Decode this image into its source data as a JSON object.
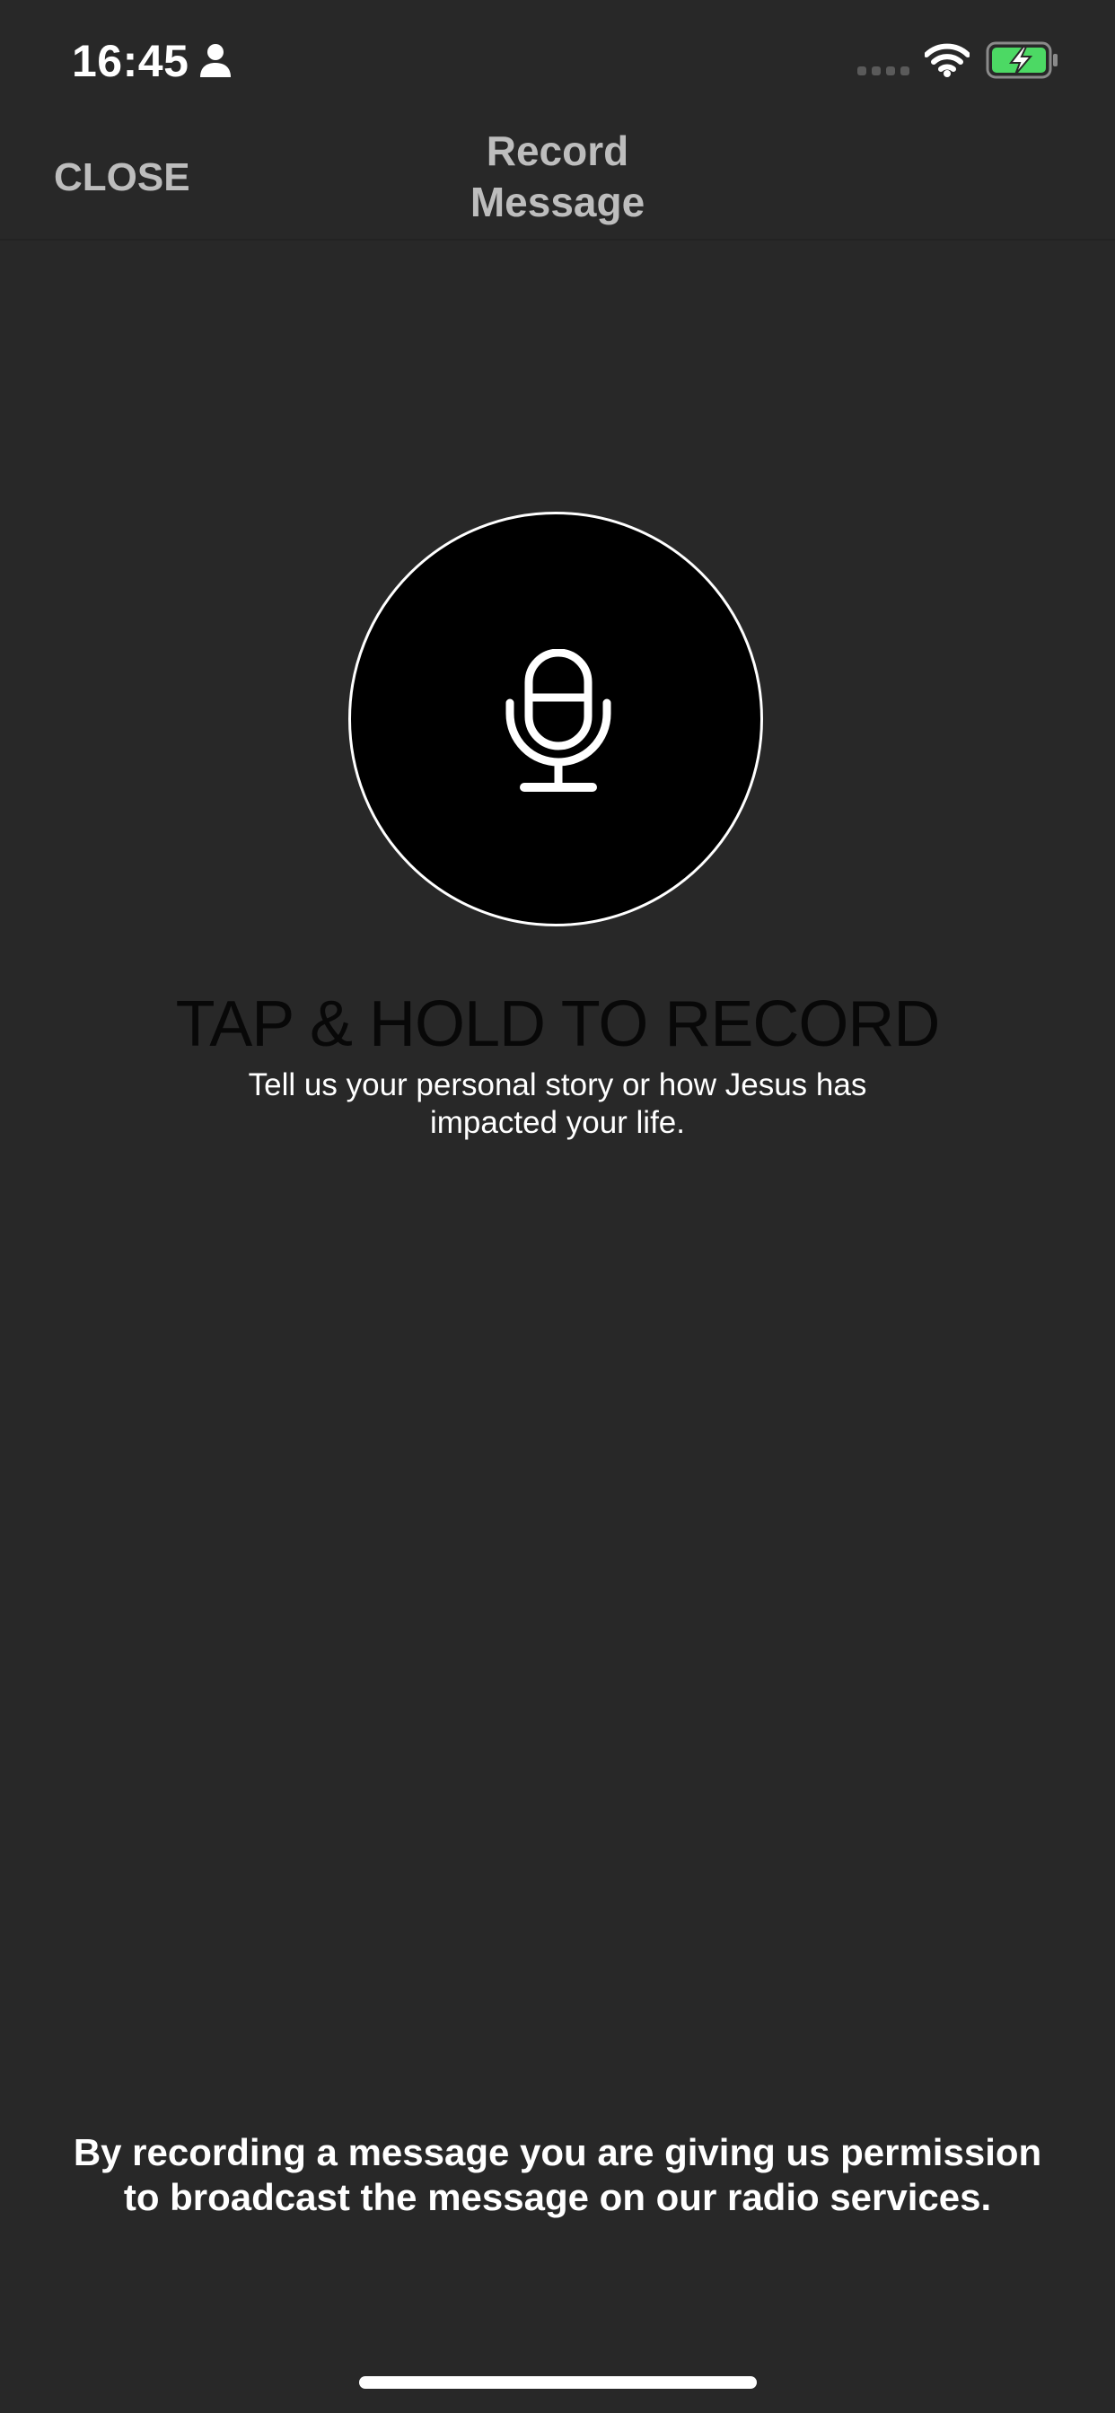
{
  "status_bar": {
    "time": "16:45",
    "icons": [
      "person-icon",
      "cellular-signal-icon",
      "wifi-icon",
      "battery-charging-icon"
    ],
    "battery_color": "#4cd964"
  },
  "nav": {
    "close_label": "CLOSE",
    "title": "Record Message"
  },
  "record": {
    "icon": "microphone-icon",
    "heading": "TAP & HOLD TO RECORD",
    "subtitle": "Tell us your personal story or how Jesus has impacted your life."
  },
  "disclaimer": "By recording a message you are giving us permission to broadcast the message on our radio services.",
  "colors": {
    "background": "#282828",
    "record_button_fill": "#000000",
    "record_button_border": "#ffffff",
    "nav_text": "#bdbdbd"
  }
}
